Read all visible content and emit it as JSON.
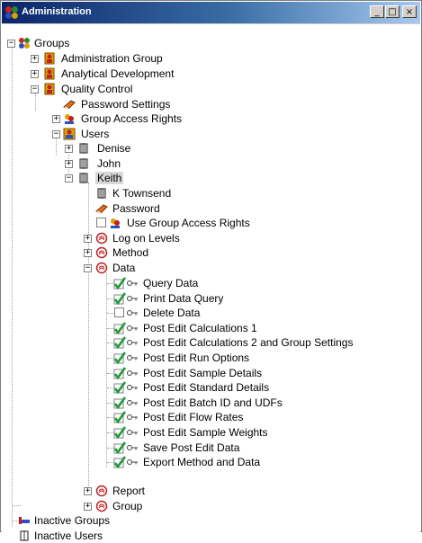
{
  "window": {
    "title": "Administration",
    "min_label": "_",
    "max_label": "□",
    "close_label": "×"
  },
  "tree": {
    "groups": "Groups",
    "administration_group": "Administration Group",
    "analytical_development": "Analytical Development",
    "quality_control": "Quality Control",
    "password_settings": "Password Settings",
    "group_access_rights": "Group Access Rights",
    "users": "Users",
    "denise": "Denise",
    "john": "John",
    "keith": "Keith",
    "k_townsend": "K Townsend",
    "password": "Password",
    "use_group_access_rights": "Use Group Access Rights",
    "log_on_levels": "Log on Levels",
    "method": "Method",
    "data": "Data",
    "data_items": [
      {
        "label": "Query Data",
        "checked": true
      },
      {
        "label": "Print Data Query",
        "checked": true
      },
      {
        "label": "Delete Data",
        "checked": false
      },
      {
        "label": "Post Edit Calculations 1",
        "checked": true
      },
      {
        "label": "Post Edit Calculations 2 and Group Settings",
        "checked": true
      },
      {
        "label": "Post Edit Run Options",
        "checked": true
      },
      {
        "label": "Post Edit Sample Details",
        "checked": true
      },
      {
        "label": "Post Edit Standard Details",
        "checked": true
      },
      {
        "label": "Post Edit Batch ID and UDFs",
        "checked": true
      },
      {
        "label": "Post Edit Flow Rates",
        "checked": true
      },
      {
        "label": "Post Edit Sample Weights",
        "checked": true
      },
      {
        "label": "Save Post Edit Data",
        "checked": true
      },
      {
        "label": "Export Method and Data",
        "checked": true
      }
    ],
    "report": "Report",
    "group": "Group",
    "inactive_groups": "Inactive Groups",
    "inactive_users": "Inactive Users"
  },
  "colors": {
    "titlebar_start": "#0a246a",
    "titlebar_end": "#a6caf0",
    "check_green": "#1f9a3a",
    "selection": "#d8d8d8"
  },
  "icons": [
    "groups-icon",
    "group-icon",
    "password-icon",
    "group-access-icon",
    "users-icon",
    "user-icon",
    "permission-folder-icon",
    "check-icon",
    "key-icon",
    "inactive-groups-icon",
    "inactive-users-icon"
  ]
}
